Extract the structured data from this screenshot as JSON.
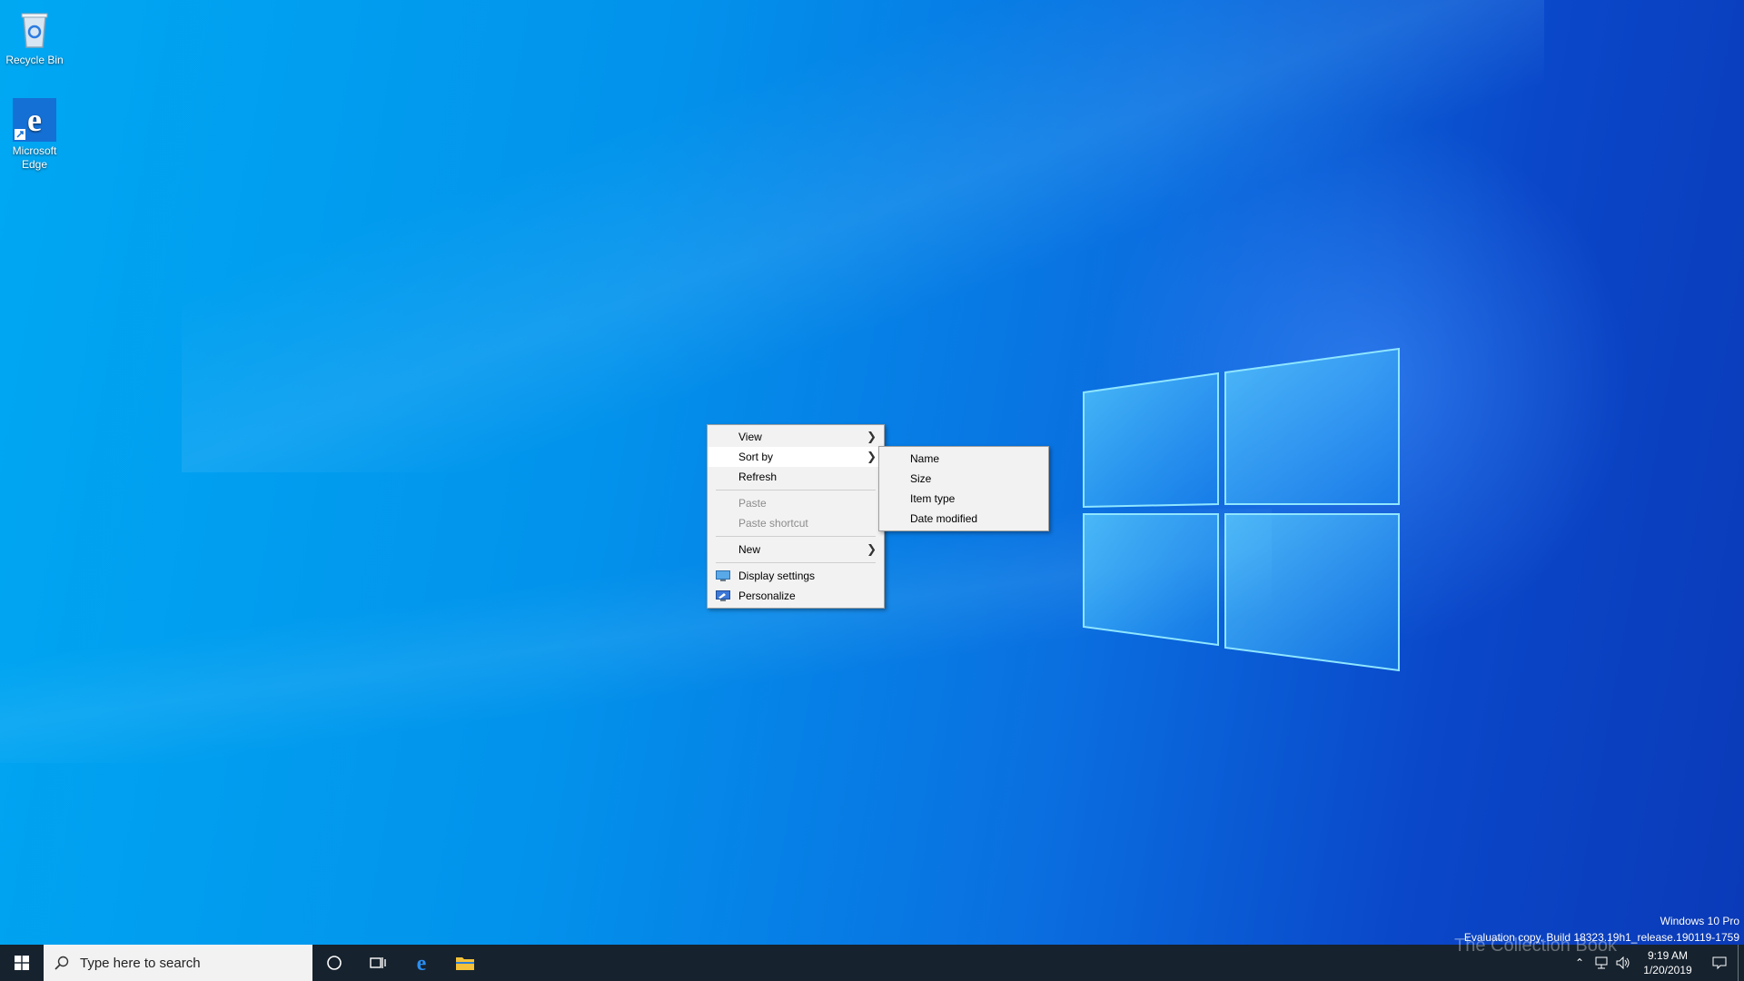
{
  "desktop_icons": [
    {
      "label": "Recycle Bin",
      "icon": "recycle-bin-icon"
    },
    {
      "label": "Microsoft Edge",
      "icon": "edge-icon"
    }
  ],
  "context_menu": {
    "items": [
      {
        "label": "View",
        "submenu": true
      },
      {
        "label": "Sort by",
        "submenu": true,
        "highlighted": true
      },
      {
        "label": "Refresh"
      },
      {
        "label": "Paste",
        "disabled": true
      },
      {
        "label": "Paste shortcut",
        "disabled": true
      },
      {
        "label": "New",
        "submenu": true
      },
      {
        "label": "Display settings",
        "icon": "display-icon"
      },
      {
        "label": "Personalize",
        "icon": "personalize-icon"
      }
    ]
  },
  "sort_submenu": {
    "items": [
      "Name",
      "Size",
      "Item type",
      "Date modified"
    ]
  },
  "watermark": {
    "line1": "Windows 10 Pro",
    "line2": "Evaluation copy. Build 18323.19h1_release.190119-1759"
  },
  "overlay_logo": "The Collection Book",
  "taskbar": {
    "search_placeholder": "Type here to search",
    "time": "9:19 AM",
    "date": "1/20/2019"
  },
  "colors": {
    "desktop_accent": "#0a7be6",
    "taskbar": "#16222e",
    "menu_bg": "#f2f2f2"
  }
}
